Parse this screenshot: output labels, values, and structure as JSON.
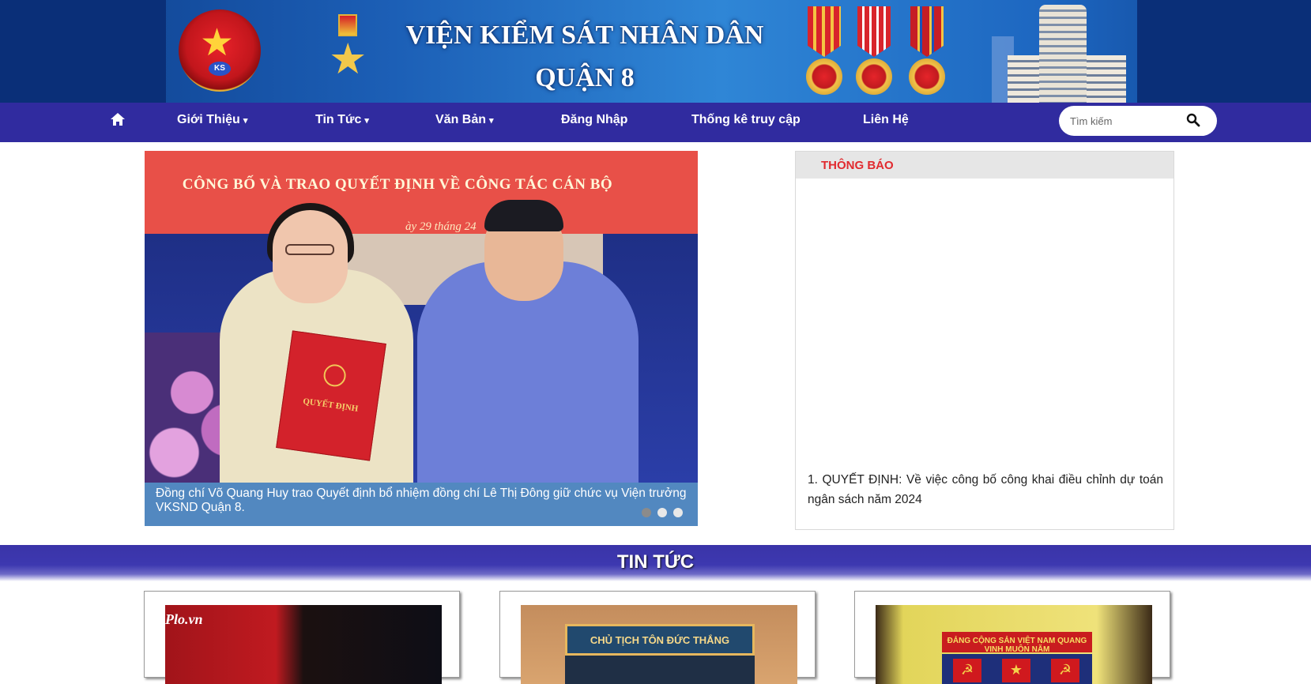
{
  "header": {
    "title_line1": "VIỆN KIỂM SÁT NHÂN DÂN",
    "title_line2": "QUẬN 8",
    "emblem_text": "KS"
  },
  "nav": {
    "home_icon": "home-icon",
    "items": [
      {
        "label": "Giới Thiệu",
        "dropdown": true
      },
      {
        "label": "Tin Tức",
        "dropdown": true
      },
      {
        "label": "Văn Bản",
        "dropdown": true
      },
      {
        "label": "Đăng Nhập",
        "dropdown": false
      },
      {
        "label": "Thống kê truy cập",
        "dropdown": false
      },
      {
        "label": "Liên Hệ",
        "dropdown": false
      }
    ],
    "caret": "▾",
    "search": {
      "placeholder": "Tìm kiếm",
      "value": "",
      "icon": "search-icon"
    }
  },
  "slider": {
    "banner_text": "CÔNG BỐ VÀ TRAO QUYẾT ĐỊNH VỀ CÔNG TÁC CÁN BỘ",
    "banner_date": "ày 29 tháng     24",
    "folder_text": "QUYẾT ĐỊNH",
    "caption": "Đồng chí Võ Quang Huy trao Quyết định bổ nhiệm đồng chí Lê Thị Đông giữ chức vụ Viện trưởng VKSND Quận 8.",
    "dots": 3,
    "active_dot": 0
  },
  "notice": {
    "title": "THÔNG BÁO",
    "items": [
      "1. QUYẾT ĐỊNH: Về việc công bố công khai điều chỉnh dự toán ngân sách năm 2024"
    ]
  },
  "news": {
    "title": "TIN TỨC",
    "cards": [
      {
        "image_tag": "Plo.vn"
      },
      {
        "image_sign": "CHỦ TỊCH TÔN ĐỨC THẮNG"
      },
      {
        "image_banner": "ĐẢNG CỘNG SẢN VIỆT NAM QUANG VINH MUÔN NĂM"
      }
    ]
  },
  "colors": {
    "nav_bg": "#302b9f",
    "notice_title": "#e12a2f",
    "caption_bg": "#5288c0"
  }
}
